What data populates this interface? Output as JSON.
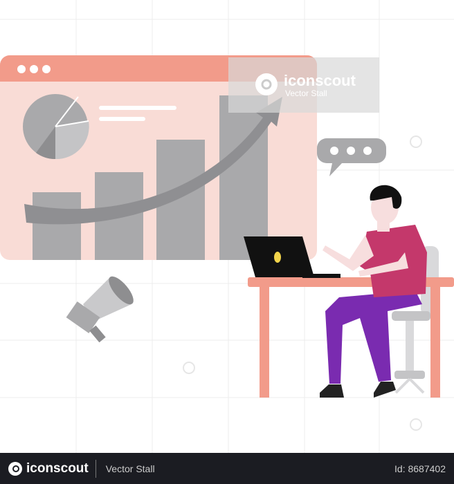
{
  "watermark": {
    "brand": "iconscout",
    "author": "Vector Stall"
  },
  "footer": {
    "brand": "iconscout",
    "author": "Vector Stall",
    "id_label": "Id: 8687402"
  },
  "colors": {
    "salmon": "#f29b8a",
    "panel": "#f9dcd6",
    "grey": "#a9a9ab",
    "shirt": "#c4386b",
    "pants": "#7a2bb0",
    "footer_bg": "#1b1c22"
  }
}
